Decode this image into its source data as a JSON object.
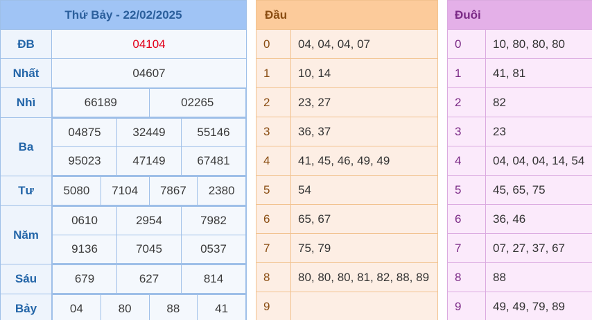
{
  "header": {
    "title": "Thứ Bảy - 22/02/2025",
    "dau_title": "Đầu",
    "duoi_title": "Đuôi"
  },
  "prizes": {
    "db": {
      "label": "ĐB",
      "values": [
        "04104"
      ]
    },
    "nhat": {
      "label": "Nhất",
      "values": [
        "04607"
      ]
    },
    "nhi": {
      "label": "Nhì",
      "values": [
        "66189",
        "02265"
      ]
    },
    "ba": {
      "label": "Ba",
      "values": [
        "04875",
        "32449",
        "55146",
        "95023",
        "47149",
        "67481"
      ]
    },
    "tu": {
      "label": "Tư",
      "values": [
        "5080",
        "7104",
        "7867",
        "2380"
      ]
    },
    "nam": {
      "label": "Năm",
      "values": [
        "0610",
        "2954",
        "7982",
        "9136",
        "7045",
        "0537"
      ]
    },
    "sau": {
      "label": "Sáu",
      "values": [
        "679",
        "627",
        "814"
      ]
    },
    "bay": {
      "label": "Bảy",
      "values": [
        "04",
        "80",
        "88",
        "41"
      ]
    }
  },
  "dau": [
    {
      "digit": "0",
      "values": "04, 04, 04, 07"
    },
    {
      "digit": "1",
      "values": "10, 14"
    },
    {
      "digit": "2",
      "values": "23, 27"
    },
    {
      "digit": "3",
      "values": "36, 37"
    },
    {
      "digit": "4",
      "values": "41, 45, 46, 49, 49"
    },
    {
      "digit": "5",
      "values": "54"
    },
    {
      "digit": "6",
      "values": "65, 67"
    },
    {
      "digit": "7",
      "values": "75, 79"
    },
    {
      "digit": "8",
      "values": "80, 80, 80, 81, 82, 88, 89"
    },
    {
      "digit": "9",
      "values": ""
    }
  ],
  "duoi": [
    {
      "digit": "0",
      "values": "10, 80, 80, 80"
    },
    {
      "digit": "1",
      "values": "41, 81"
    },
    {
      "digit": "2",
      "values": "82"
    },
    {
      "digit": "3",
      "values": "23"
    },
    {
      "digit": "4",
      "values": "04, 04, 04, 14, 54"
    },
    {
      "digit": "5",
      "values": "45, 65, 75"
    },
    {
      "digit": "6",
      "values": "36, 46"
    },
    {
      "digit": "7",
      "values": "07, 27, 37, 67"
    },
    {
      "digit": "8",
      "values": "88"
    },
    {
      "digit": "9",
      "values": "49, 49, 79, 89"
    }
  ]
}
